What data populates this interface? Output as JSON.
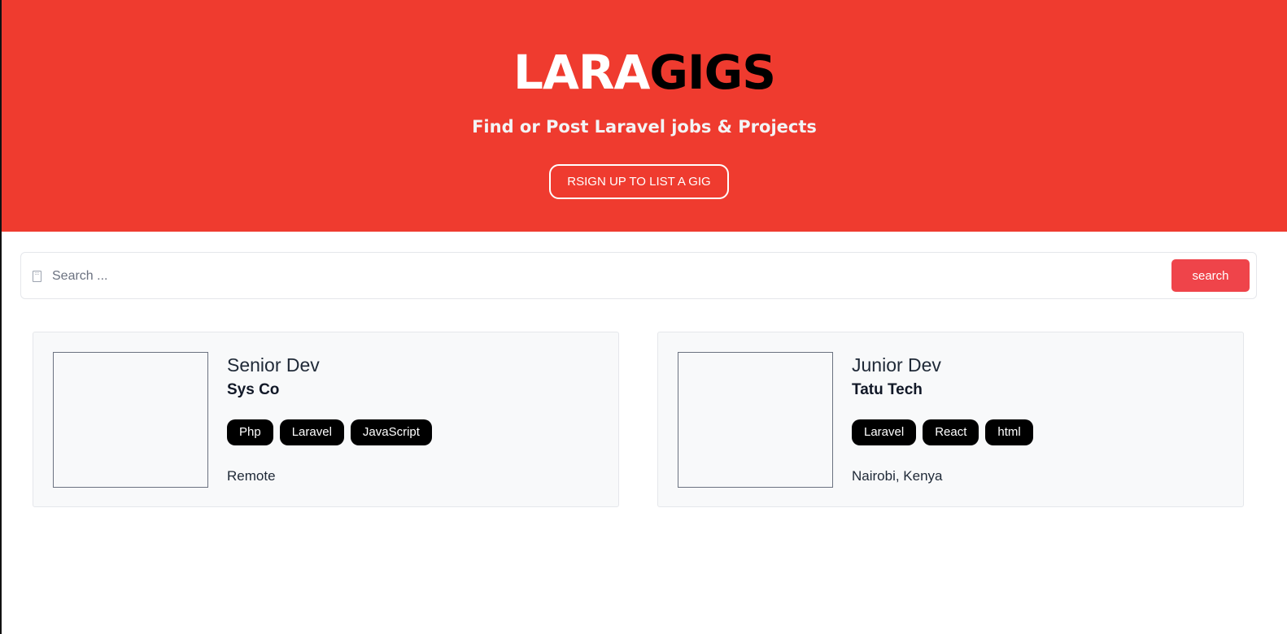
{
  "hero": {
    "logo_part_1": "LARA",
    "logo_part_2": "GIGS",
    "tagline": "Find or Post Laravel jobs & Projects",
    "cta_label": "RSIGN UP TO LIST A GIG"
  },
  "search": {
    "placeholder": "Search ...",
    "button_label": "search"
  },
  "colors": {
    "brand_red": "#ef3b2f",
    "search_button": "#ef444a",
    "tag_background": "#000000",
    "card_background": "#f8f9fa"
  },
  "gigs": [
    {
      "title": "Senior Dev",
      "company": "Sys Co",
      "tags": [
        "Php",
        "Laravel",
        "JavaScript"
      ],
      "location": "Remote"
    },
    {
      "title": "Junior Dev",
      "company": "Tatu Tech",
      "tags": [
        "Laravel",
        "React",
        "html"
      ],
      "location": "Nairobi, Kenya"
    }
  ]
}
